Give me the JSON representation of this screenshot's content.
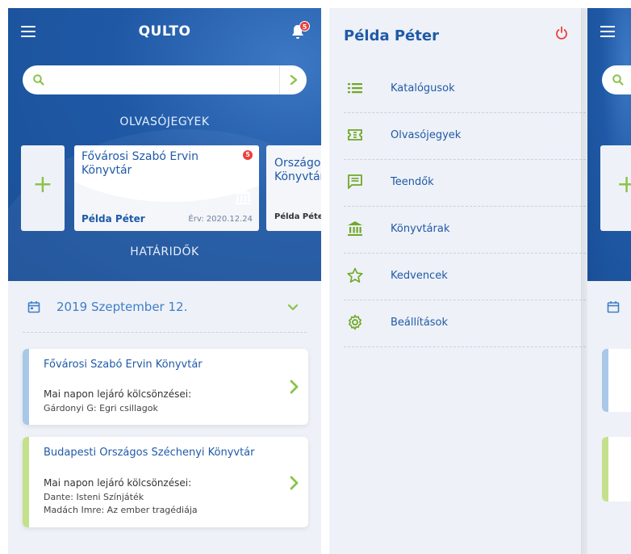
{
  "screen1": {
    "app_title": "QULTO",
    "notification_count": "5",
    "search": {
      "placeholder": ""
    },
    "section_tickets": "OLVASÓJEGYEK",
    "add_label": "+",
    "ticket": {
      "library": "Fővárosi Szabó Ervin Könyvtár",
      "badge": "5",
      "owner": "Példa Péter",
      "valid": "Érv: 2020.12.24"
    },
    "ticket_partial": {
      "library_line1": "Országos",
      "library_line2": "Könyvtár",
      "owner": "Példa Péter"
    },
    "section_deadlines": "HATÁRIDŐK",
    "date": "2019 Szeptember 12.",
    "loans": [
      {
        "library": "Fővárosi Szabó Ervin Könyvtár",
        "label": "Mai napon lejáró kölcsönzései:",
        "items": [
          "Gárdonyi G: Egri csillagok"
        ],
        "color": "#a9c8e8"
      },
      {
        "library": "Budapesti Országos Széchenyi Könyvtár",
        "label": "Mai napon lejáró kölcsönzései:",
        "items": [
          "Dante: Isteni Színjáték",
          "Madách Imre: Az ember tragédiája"
        ],
        "color": "#c5e08a"
      }
    ]
  },
  "screen2": {
    "user_name": "Példa Péter",
    "menu": [
      {
        "label": "Katalógusok",
        "icon": "list-icon"
      },
      {
        "label": "Olvasójegyek",
        "icon": "ticket-icon"
      },
      {
        "label": "Teendők",
        "icon": "message-icon"
      },
      {
        "label": "Könyvtárak",
        "icon": "library-icon"
      },
      {
        "label": "Kedvencek",
        "icon": "star-icon"
      },
      {
        "label": "Beállítások",
        "icon": "gear-icon"
      }
    ]
  },
  "colors": {
    "primary": "#1f5aa8",
    "accent": "#8bc34a",
    "badge": "#e8413c",
    "power": "#e8413c"
  }
}
